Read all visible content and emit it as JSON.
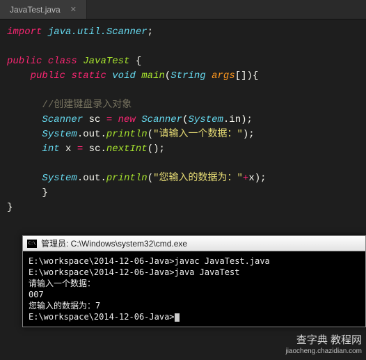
{
  "tab": {
    "filename": "JavaTest.java"
  },
  "code": {
    "l1_import": "import",
    "l1_pkg": " java.util.Scanner",
    "l1_semi": ";",
    "l3_public": "public",
    "l3_class": "class",
    "l3_name": " JavaTest ",
    "l3_brace": "{",
    "l4_public": "public",
    "l4_static": "static",
    "l4_void": "void",
    "l4_main": "main",
    "l4_open": "(",
    "l4_string": "String",
    "l4_args": " args",
    "l4_arr": "[]",
    "l4_close": "){",
    "l6_comment": "//创建键盘录入对象",
    "l7_type": "Scanner",
    "l7_var": " sc ",
    "l7_eq": "=",
    "l7_new": " new",
    "l7_ctor": " Scanner",
    "l7_open": "(",
    "l7_sys": "System",
    "l7_in": ".in",
    "l7_close": ");",
    "l8_sys": "System",
    "l8_dot1": ".",
    "l8_out": "out",
    "l8_dot2": ".",
    "l8_println": "println",
    "l8_open": "(",
    "l8_str": "\"请输入一个数据：\"",
    "l8_close": ");",
    "l9_int": "int",
    "l9_var": " x ",
    "l9_eq": "=",
    "l9_sc": " sc",
    "l9_dot": ".",
    "l9_next": "nextInt",
    "l9_paren": "();",
    "l11_sys": "System",
    "l11_dot1": ".",
    "l11_out": "out",
    "l11_dot2": ".",
    "l11_println": "println",
    "l11_open": "(",
    "l11_str": "\"您输入的数据为：\"",
    "l11_plus": "+",
    "l11_x": "x",
    "l11_close": ");",
    "l12_brace": "}",
    "l13_brace": "}"
  },
  "cmd": {
    "title": "管理员: C:\\Windows\\system32\\cmd.exe",
    "line1": "E:\\workspace\\2014-12-06-Java>javac JavaTest.java",
    "line2": "",
    "line3": "E:\\workspace\\2014-12-06-Java>java JavaTest",
    "line4": "请输入一个数据：",
    "line5": "007",
    "line6": "您输入的数据为：7",
    "line7": "",
    "line8": "E:\\workspace\\2014-12-06-Java>"
  },
  "watermark": {
    "main": "查字典 教程网",
    "sub": "jiaocheng.chazidian.com"
  }
}
